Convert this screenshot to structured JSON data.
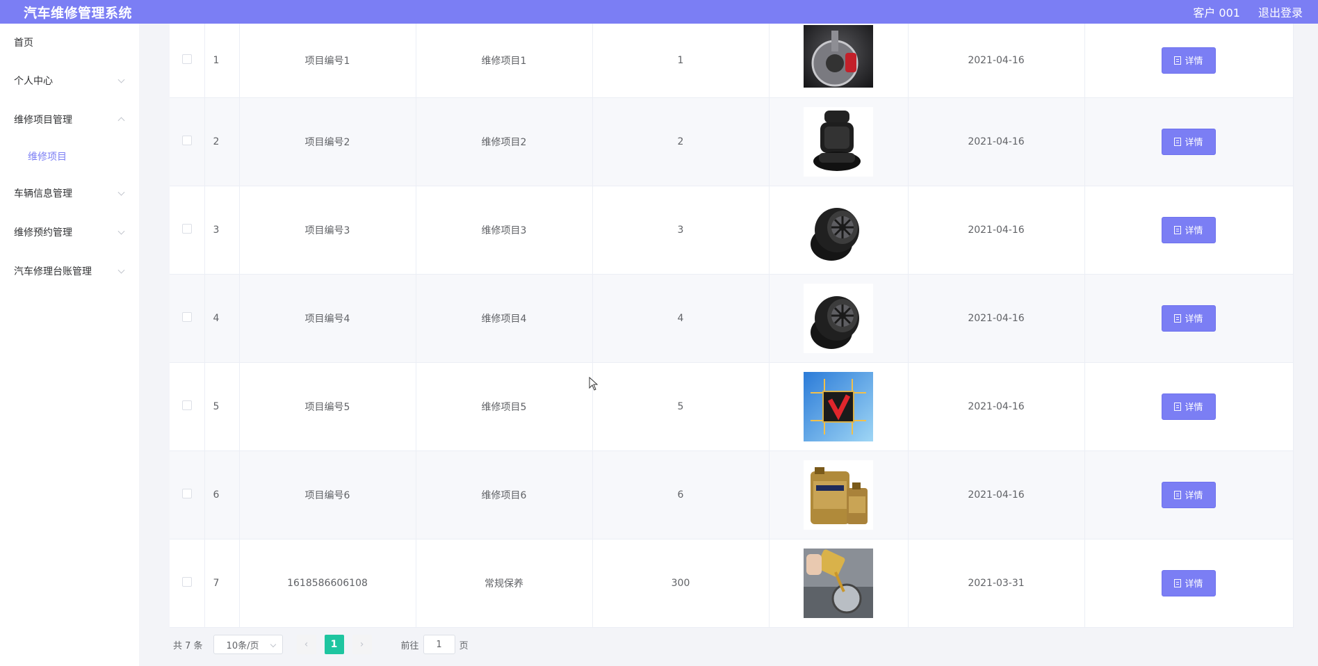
{
  "header": {
    "title": "汽车维修管理系统",
    "user": "客户 001",
    "logout": "退出登录"
  },
  "sidebar": {
    "items": [
      {
        "label": "首页"
      },
      {
        "label": "个人中心"
      },
      {
        "label": "维修项目管理",
        "sub": "维修项目"
      },
      {
        "label": "车辆信息管理"
      },
      {
        "label": "维修预约管理"
      },
      {
        "label": "汽车修理台账管理"
      }
    ]
  },
  "table": {
    "detail_label": "详情",
    "rows": [
      {
        "index": "1",
        "code": "项目编号1",
        "name": "维修项目1",
        "price": "1",
        "image": "brake-disc",
        "date": "2021-04-16"
      },
      {
        "index": "2",
        "code": "项目编号2",
        "name": "维修项目2",
        "price": "2",
        "image": "car-seat",
        "date": "2021-04-16"
      },
      {
        "index": "3",
        "code": "项目编号3",
        "name": "维修项目3",
        "price": "3",
        "image": "tires",
        "date": "2021-04-16"
      },
      {
        "index": "4",
        "code": "项目编号4",
        "name": "维修项目4",
        "price": "4",
        "image": "tires",
        "date": "2021-04-16"
      },
      {
        "index": "5",
        "code": "项目编号5",
        "name": "维修项目5",
        "price": "5",
        "image": "chip",
        "date": "2021-04-16"
      },
      {
        "index": "6",
        "code": "项目编号6",
        "name": "维修项目6",
        "price": "6",
        "image": "engine-oil",
        "date": "2021-04-16"
      },
      {
        "index": "7",
        "code": "1618586606108",
        "name": "常规保养",
        "price": "300",
        "image": "oil-change",
        "date": "2021-03-31"
      }
    ]
  },
  "pagination": {
    "total": "共 7 条",
    "page_size": "10条/页",
    "current_page": "1",
    "goto_label": "前往",
    "goto_value": "1",
    "page_suffix": "页"
  },
  "colors": {
    "accent": "#7b7ef4",
    "active_page": "#1ec5a0"
  }
}
